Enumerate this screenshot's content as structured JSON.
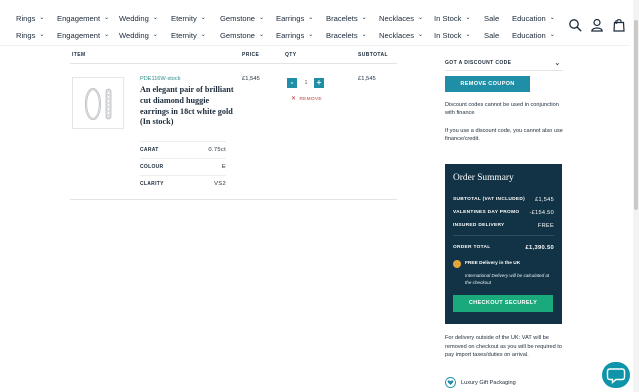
{
  "nav": {
    "row1": [
      "Rings",
      "Engagement",
      "Wedding",
      "Eternity",
      "Gemstone",
      "Earrings",
      "Bracelets",
      "Necklaces",
      "In Stock",
      "Sale",
      "Education"
    ],
    "row2": [
      "Rings",
      "Engagement",
      "Wedding",
      "Eternity",
      "Gemstone",
      "Earrings",
      "Bracelets",
      "Necklaces",
      "In Stock",
      "Sale",
      "Education"
    ],
    "cart_count": "0"
  },
  "table": {
    "headers": {
      "item": "ITEM",
      "price": "PRICE",
      "qty": "QTY",
      "subtotal": "SUBTOTAL"
    }
  },
  "product": {
    "sku": "PDE116W-stock",
    "title": "An elegant pair of brilliant cut diamond huggie earrings in 18ct white gold (In stock)",
    "price": "£1,545",
    "subtotal": "£1,545",
    "qty": "1",
    "minus": "-",
    "plus": "+",
    "remove": "REMOVE",
    "specs": [
      {
        "key": "CARAT",
        "value": "0.75ct"
      },
      {
        "key": "COLOUR",
        "value": "E"
      },
      {
        "key": "CLARITY",
        "value": "VS2"
      }
    ]
  },
  "discount": {
    "title": "GOT A DISCOUNT CODE",
    "remove_coupon": "REMOVE COUPON",
    "note1": "Discount codes cannot be used in conjunction with finance",
    "note2": "If you use a discount code, you cannot also use finance/credit."
  },
  "summary": {
    "title": "Order Summary",
    "subtotal_label": "SUBTOTAL (VAT INCLUDED)",
    "subtotal_value": "£1,545",
    "promo_label": "VALENTINES DAY PROMO",
    "promo_value": "-£154.50",
    "delivery_label": "INSURED DELIVERY",
    "delivery_value": "FREE",
    "total_label": "ORDER TOTAL",
    "total_value": "£1,390.50",
    "free_delivery": "FREE Delivery in the UK",
    "intl_note": "International Delivery will be calculated at the checkout",
    "checkout": "CHECKOUT SECURELY"
  },
  "outside_uk_note": "For delivery outside of the UK: VAT will be removed on checkout as you will be required to pay import taxes/duties on arrival.",
  "luxury_packaging": "Luxury Gift Packaging",
  "colors": {
    "teal": "#1f8fa7",
    "navy": "#123345",
    "green": "#19a97b",
    "remove_red": "#c23a3a"
  }
}
